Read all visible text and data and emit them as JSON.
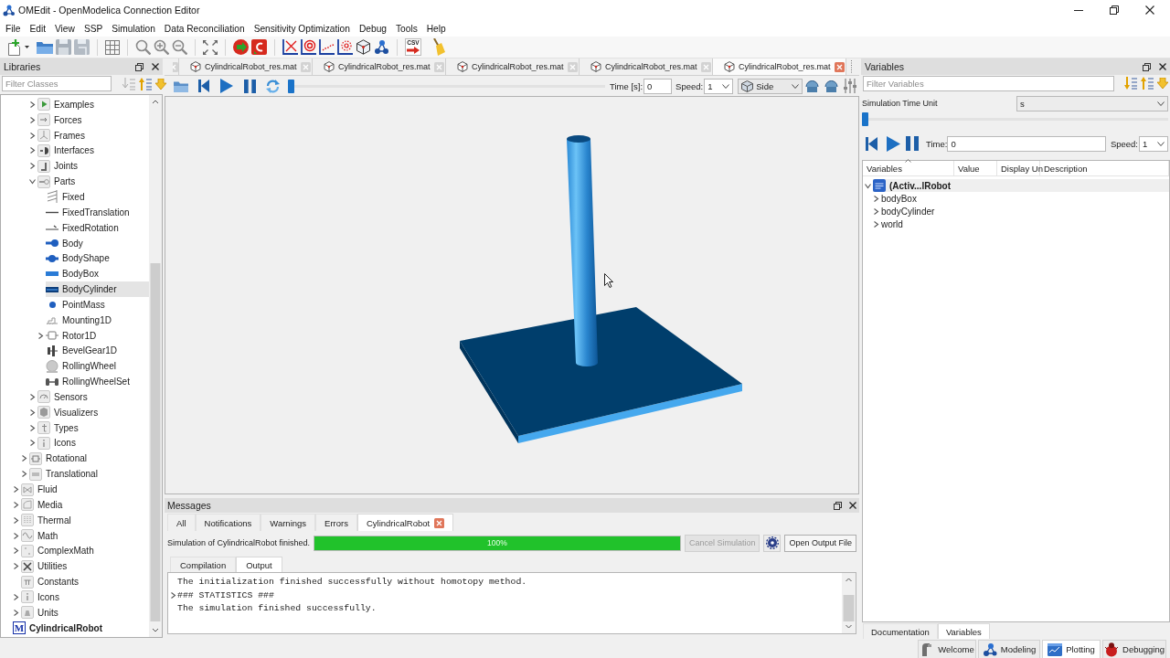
{
  "window": {
    "title": "OMEdit - OpenModelica Connection Editor"
  },
  "menu": [
    "File",
    "Edit",
    "View",
    "SSP",
    "Simulation",
    "Data Reconciliation",
    "Sensitivity Optimization",
    "Debug",
    "Tools",
    "Help"
  ],
  "toolbar": {
    "csv_label": "CSV"
  },
  "libraries": {
    "title": "Libraries",
    "filter": {
      "placeholder": "Filter Classes"
    },
    "tree": [
      {
        "children": [
          {
            "children": [
              {
                "children": [
                  {
                    "label": "Examples",
                    "expanded": false,
                    "selected": false
                  },
                  {
                    "label": "Forces",
                    "expanded": false,
                    "selected": false
                  },
                  {
                    "label": "Frames",
                    "expanded": false,
                    "selected": false
                  },
                  {
                    "label": "Interfaces",
                    "expanded": false,
                    "selected": false
                  },
                  {
                    "label": "Joints",
                    "expanded": false,
                    "selected": false
                  },
                  {
                    "label": "Parts",
                    "expanded": true,
                    "selected": false,
                    "children": [
                      {
                        "label": "Fixed",
                        "selected": false
                      },
                      {
                        "label": "FixedTranslation",
                        "selected": false
                      },
                      {
                        "label": "FixedRotation",
                        "selected": false
                      },
                      {
                        "label": "Body",
                        "selected": false
                      },
                      {
                        "label": "BodyShape",
                        "selected": false
                      },
                      {
                        "label": "BodyBox",
                        "selected": false
                      },
                      {
                        "label": "BodyCylinder",
                        "selected": true
                      },
                      {
                        "label": "PointMass",
                        "selected": false
                      },
                      {
                        "label": "Mounting1D",
                        "selected": false
                      },
                      {
                        "label": "Rotor1D",
                        "expanded": false,
                        "selected": false
                      },
                      {
                        "label": "BevelGear1D",
                        "selected": false
                      },
                      {
                        "label": "RollingWheel",
                        "selected": false
                      },
                      {
                        "label": "RollingWheelSet",
                        "selected": false
                      }
                    ]
                  },
                  {
                    "label": "Sensors",
                    "expanded": false,
                    "selected": false
                  },
                  {
                    "label": "Visualizers",
                    "expanded": false,
                    "selected": false
                  },
                  {
                    "label": "Types",
                    "expanded": false,
                    "selected": false
                  },
                  {
                    "label": "Icons",
                    "expanded": false,
                    "selected": false
                  }
                ]
              },
              {
                "label": "Rotational",
                "expanded": false,
                "selected": false
              },
              {
                "label": "Translational",
                "expanded": false,
                "selected": false
              }
            ]
          },
          {
            "label": "Fluid",
            "expanded": false,
            "selected": false
          },
          {
            "label": "Media",
            "expanded": false,
            "selected": false
          },
          {
            "label": "Thermal",
            "expanded": false,
            "selected": false
          },
          {
            "label": "Math",
            "expanded": false,
            "selected": false
          },
          {
            "label": "ComplexMath",
            "expanded": false,
            "selected": false
          },
          {
            "label": "Utilities",
            "expanded": false,
            "selected": false
          },
          {
            "label": "Constants",
            "selected": false
          },
          {
            "label": "Icons",
            "expanded": false,
            "selected": false
          },
          {
            "label": "Units",
            "expanded": false,
            "selected": false
          }
        ]
      },
      {
        "label": "CylindricalRobot",
        "icon_text": "M",
        "selected": false
      }
    ]
  },
  "document_tabs": [
    {
      "label": "CylindricalRobot_res.mat",
      "selected": false
    },
    {
      "label": "CylindricalRobot_res.mat",
      "selected": false
    },
    {
      "label": "CylindricalRobot_res.mat",
      "selected": false
    },
    {
      "label": "CylindricalRobot_res.mat",
      "selected": false
    },
    {
      "label": "CylindricalRobot_res.mat",
      "selected": true
    }
  ],
  "animation": {
    "slider": {
      "level": 0
    },
    "time_label": "Time [s]:",
    "time": "0",
    "speed_label": "Speed:",
    "speed": "1",
    "view": "Side"
  },
  "messages": {
    "title": "Messages",
    "tabs": [
      {
        "label": "All",
        "selected": false,
        "closable": false
      },
      {
        "label": "Notifications",
        "selected": false,
        "closable": false
      },
      {
        "label": "Warnings",
        "selected": false,
        "closable": false
      },
      {
        "label": "Errors",
        "selected": false,
        "closable": false
      },
      {
        "label": "CylindricalRobot",
        "selected": true,
        "closable": true
      }
    ],
    "status": "Simulation of CylindricalRobot finished.",
    "progress": {
      "level": 1,
      "text": "100%"
    },
    "buttons": [
      {
        "label": "Cancel Simulation",
        "disabled": true
      },
      {
        "label": "Open Output File",
        "disabled": false
      }
    ],
    "output_tabs": [
      {
        "label": "Compilation",
        "selected": false
      },
      {
        "label": "Output",
        "selected": true
      }
    ],
    "output_lines": [
      {
        "text": "The initialization finished successfully without homotopy method."
      },
      {
        "text": "### STATISTICS ###",
        "expanded": false
      },
      {
        "text": "The simulation finished successfully."
      }
    ]
  },
  "variables": {
    "title": "Variables",
    "filter": {
      "placeholder": "Filter Variables"
    },
    "time_unit_label": "Simulation Time Unit",
    "time_unit": "s",
    "slider": {
      "level": 0
    },
    "time_label": "Time:",
    "time": "0",
    "speed_label": "Speed:",
    "speed": "1",
    "columns": [
      "Variables",
      "Value",
      "Display Un",
      "Description"
    ],
    "tree": [
      {
        "label": "(Activ...lRobot",
        "expanded": true,
        "selected": true,
        "children": [
          {
            "label": "bodyBox",
            "expanded": false,
            "selected": false
          },
          {
            "label": "bodyCylinder",
            "expanded": false,
            "selected": false
          },
          {
            "label": "world",
            "expanded": false,
            "selected": false
          }
        ]
      }
    ],
    "tabs": [
      {
        "label": "Documentation",
        "selected": false
      },
      {
        "label": "Variables",
        "selected": true
      }
    ]
  },
  "perspectives": [
    {
      "label": "Welcome",
      "selected": false
    },
    {
      "label": "Modeling",
      "selected": false
    },
    {
      "label": "Plotting",
      "selected": true
    },
    {
      "label": "Debugging",
      "selected": false
    }
  ]
}
